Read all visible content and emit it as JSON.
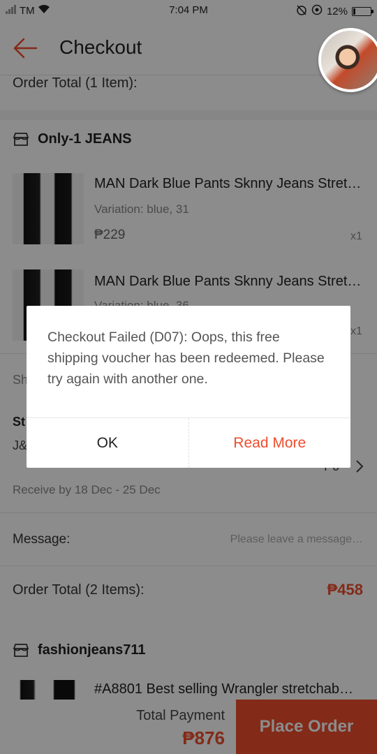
{
  "status_bar": {
    "carrier": "TM",
    "time": "7:04 PM",
    "battery_percent": "12%"
  },
  "header": {
    "title": "Checkout"
  },
  "order_total_top": {
    "label": "Order Total (1 Item):"
  },
  "shop1": {
    "name": "Only-1 JEANS",
    "items": [
      {
        "title": "MAN Dark Blue Pants Sknny Jeans Stret…",
        "variation": "Variation: blue, 31",
        "price": "₱229",
        "qty": "x1"
      },
      {
        "title": "MAN Dark Blue Pants Sknny Jeans Stret…",
        "variation": "Variation: blue, 36",
        "price": "",
        "qty": "x1"
      }
    ],
    "shipping_section_partial": "Sh",
    "shipping_title_partial": "St",
    "shipping_courier_partial": "J&",
    "shipping_fee_partial": "₱0",
    "receive_by": "Receive by 18 Dec - 25 Dec",
    "message_label": "Message:",
    "message_placeholder": "Please leave a message…",
    "order_total_label": "Order Total (2 Items):",
    "order_total_value": "₱458"
  },
  "shop2": {
    "name": "fashionjeans711",
    "item_title": "#A8801 Best selling Wrangler stretchab…"
  },
  "bottom": {
    "total_label": "Total Payment",
    "total_value": "₱876",
    "place_order": "Place Order"
  },
  "dialog": {
    "message": "Checkout Failed (D07): Oops, this free shipping voucher has been redeemed. Please try again with another one.",
    "ok": "OK",
    "read_more": "Read More"
  },
  "colors": {
    "accent": "#ee4d2d"
  }
}
